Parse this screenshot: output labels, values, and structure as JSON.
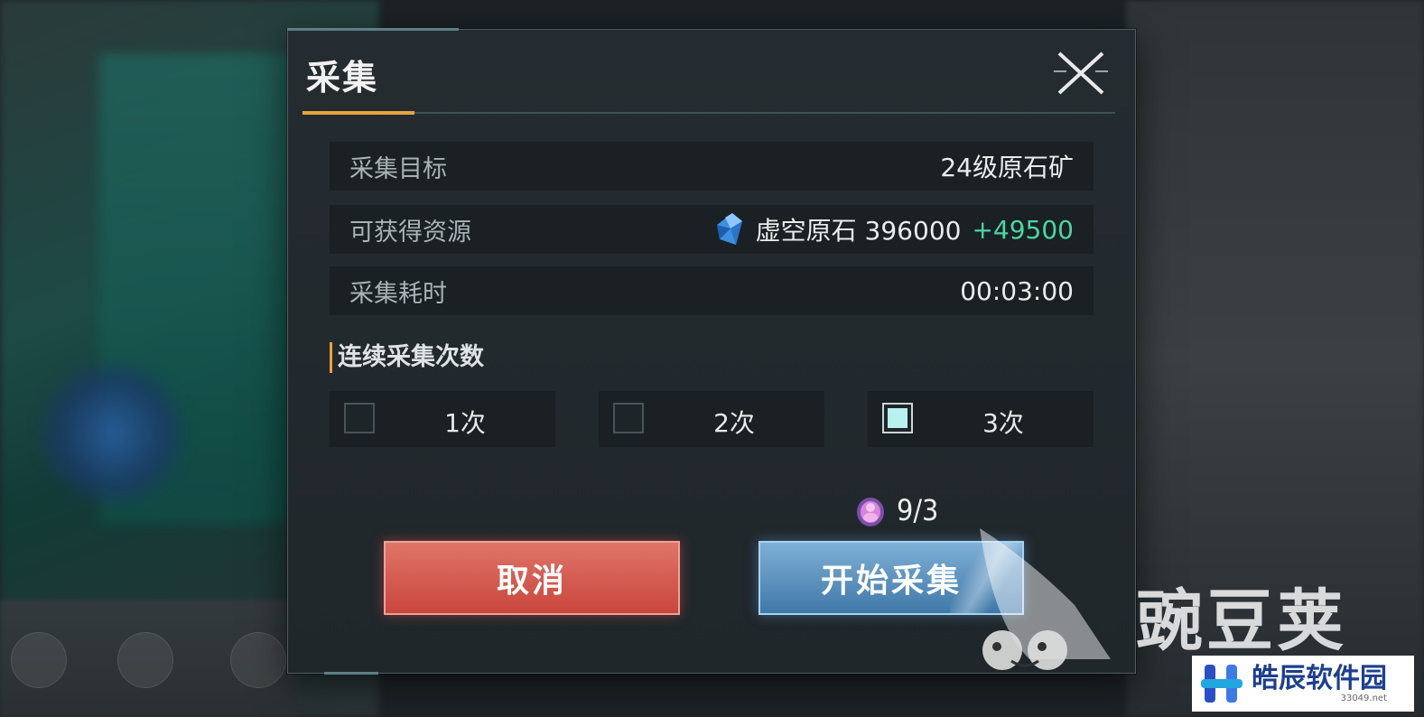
{
  "dialog": {
    "title": "采集",
    "close_icon": "close-x-icon"
  },
  "info_rows": [
    {
      "label": "采集目标",
      "value": "24级原石矿"
    },
    {
      "label": "可获得资源",
      "resource_icon": "crystal-gem-icon",
      "value": "虚空原石 396000",
      "bonus": "+49500"
    },
    {
      "label": "采集耗时",
      "value": "00:03:00"
    }
  ],
  "repeat": {
    "label": "连续采集次数",
    "options": [
      {
        "label": "1次",
        "checked": false
      },
      {
        "label": "2次",
        "checked": false
      },
      {
        "label": "3次",
        "checked": true
      }
    ]
  },
  "stamina": {
    "icon": "energy-orb-icon",
    "value": "9/3"
  },
  "buttons": {
    "cancel": "取消",
    "start": "开始采集"
  },
  "watermarks": {
    "primary": "豌豆荚",
    "secondary_name": "皓辰软件园",
    "secondary_url": "33049.net"
  },
  "colors": {
    "accent_orange": "#e8a23a",
    "bonus_green": "#4bd6a0",
    "time_blue": "#9eb7dd",
    "cancel_red": "#c9463d",
    "start_blue": "#3f78a8"
  }
}
